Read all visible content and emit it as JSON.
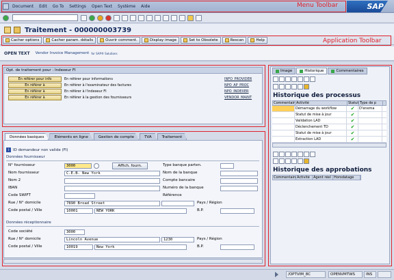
{
  "menu": {
    "items": [
      "Document",
      "Edit",
      "Go To",
      "Settings",
      "Open Text",
      "Système",
      "Aide"
    ],
    "annotation": "Menu Toolbar",
    "logo_text": "SAP"
  },
  "title": "Traitement - 000000003739",
  "app_toolbar": {
    "annotation": "Application Toolbar",
    "buttons": [
      "Cacher options",
      "Cacher param. détails",
      "Ouvrir comment.",
      "Display image",
      "Set to Obsolete",
      "Rescan",
      "Help"
    ]
  },
  "opentext": {
    "brand": "OPEN TEXT",
    "product": "Vendor Invoice Management",
    "suffix": "for SAP® Solutions"
  },
  "options": {
    "header": "Opt. de traitement pour : Indexeur FI",
    "rows": [
      {
        "button": "En référer pour info",
        "desc": "En référer pour informations",
        "code": "INFO_PROVIDER"
      },
      {
        "button": "En référer à",
        "desc": "En référer à l'examinateur des factures",
        "code": "NPO_AP_PROC"
      },
      {
        "button": "En référer à",
        "desc": "En référer à l'indexeur FI",
        "code": "NPO_INDEXER"
      },
      {
        "button": "En référer à",
        "desc": "En référer à la gestion des fournisseurs",
        "code": "VENDOR_MAINT"
      }
    ]
  },
  "tabs": [
    "Données basiques",
    "Eléments en ligne",
    "Gestion de compte",
    "TVA",
    "Traitement"
  ],
  "info_line": "ID demandeur non valide (FI)",
  "vendor_group": {
    "title": "Données fournisseur",
    "labels": {
      "vendor_no": "N° fournisseur",
      "vendor_name": "Nom fournisseur",
      "name2": "Nom 2",
      "iban": "IBAN",
      "swift": "Code SWIFT",
      "street": "Rue / N° domicile",
      "postal": "Code postal / Ville",
      "bank_type": "Type banque parten.",
      "bank_name": "Nom de la banque",
      "bank_account": "Compte bancaire",
      "bank_number": "Numéro de la banque",
      "reference": "Référence",
      "country": "Pays / Région",
      "po_box": "B.P."
    },
    "values": {
      "vendor_no": "3000",
      "vendor_name": "C.E.B. New York",
      "street": "7890 Broad Street",
      "postal": "10001",
      "city": "NEW YORK"
    },
    "display_button": "Affich. fourn."
  },
  "receiver_group": {
    "title": "Données réceptionnaire",
    "labels": {
      "company_code": "Code société",
      "street": "Rue / N° domicile",
      "postal": "Code postal / Ville",
      "country": "Pays / Région",
      "po_box": "B.P."
    },
    "values": {
      "company_code": "3000",
      "street": "Lincoln Avenue",
      "house_no": "1230",
      "postal": "10019",
      "city": "New York"
    }
  },
  "right_tabs": [
    "Image",
    "Historique",
    "Commentaires"
  ],
  "process_history": {
    "title": "Historique des processus",
    "columns": [
      "Commentaire",
      "Activité",
      "Statut",
      "Type de p"
    ],
    "rows": [
      {
        "activity": "Démarrage du workflow",
        "status": "ok",
        "type": "D'enema"
      },
      {
        "activity": "Statut de mise à jour",
        "status": "ok",
        "type": ""
      },
      {
        "activity": "Validation LAD",
        "status": "ok",
        "type": ""
      },
      {
        "activity": "Déclenchement TD",
        "status": "ok",
        "type": ""
      },
      {
        "activity": "Statut de mise à jour",
        "status": "ok",
        "type": ""
      },
      {
        "activity": "Extraction LAD",
        "status": "ok",
        "type": ""
      }
    ]
  },
  "approval_history": {
    "title": "Historique des approbations",
    "columns": [
      "Commentaire",
      "Activité",
      "Agent réel",
      "Horodatage"
    ]
  },
  "statusbar": {
    "system": "/OPTVIM_8C",
    "server": "OPENVMTWS",
    "mode": "INS"
  },
  "colors": {
    "annotation_red": "#e0202a",
    "ok_check": "#14a019",
    "sap_blue": "#1a4b98"
  }
}
